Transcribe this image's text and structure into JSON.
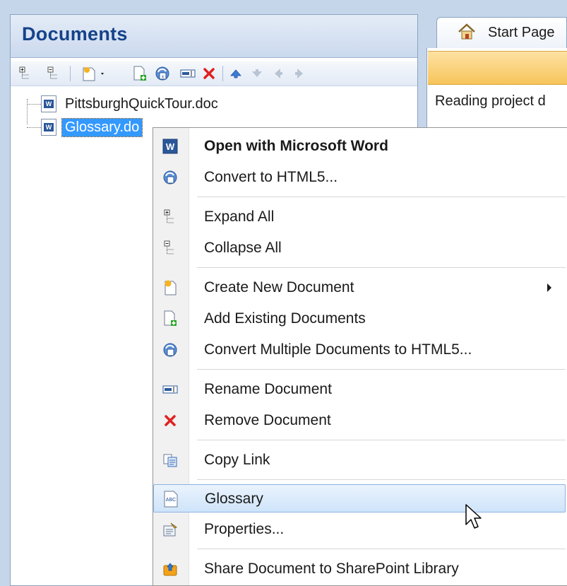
{
  "panel": {
    "title": "Documents",
    "toolbar": [
      {
        "name": "expand-all-tool",
        "icon": "expand-tree-icon"
      },
      {
        "name": "collapse-all-tool",
        "icon": "collapse-tree-icon"
      },
      {
        "name": "new-document-tool",
        "icon": "new-document-icon"
      },
      {
        "name": "add-existing-tool",
        "icon": "add-document-icon"
      },
      {
        "name": "convert-tool",
        "icon": "convert-icon"
      },
      {
        "name": "rename-tool",
        "icon": "rename-icon"
      },
      {
        "name": "remove-tool",
        "icon": "remove-icon"
      },
      {
        "name": "move-up-tool",
        "icon": "arrow-up-icon"
      },
      {
        "name": "move-down-tool",
        "icon": "arrow-down-icon"
      },
      {
        "name": "move-left-tool",
        "icon": "arrow-left-icon"
      },
      {
        "name": "move-right-tool",
        "icon": "arrow-right-icon"
      }
    ],
    "tree": [
      {
        "label": "PittsburghQuickTour.doc",
        "selected": false
      },
      {
        "label": "Glossary.do",
        "selected": true
      }
    ]
  },
  "start_tab": {
    "label": "Start Page",
    "status_text": "Reading project d"
  },
  "context_menu": {
    "items": [
      {
        "label": "Open with Microsoft Word",
        "icon": "word-icon",
        "bold": true
      },
      {
        "label": "Convert to HTML5...",
        "icon": "convert-icon"
      },
      {
        "label": "Expand All",
        "icon": "expand-tree-icon"
      },
      {
        "label": "Collapse All",
        "icon": "collapse-tree-icon"
      },
      {
        "label": "Create New Document",
        "icon": "new-document-icon",
        "submenu": true
      },
      {
        "label": "Add Existing Documents",
        "icon": "add-document-icon"
      },
      {
        "label": "Convert Multiple Documents to HTML5...",
        "icon": "convert-icon"
      },
      {
        "label": "Rename Document",
        "icon": "rename-icon"
      },
      {
        "label": "Remove Document",
        "icon": "remove-icon"
      },
      {
        "label": "Copy Link",
        "icon": "copy-link-icon"
      },
      {
        "label": "Glossary",
        "icon": "glossary-icon",
        "highlighted": true
      },
      {
        "label": "Properties...",
        "icon": "properties-icon"
      },
      {
        "label": "Share Document to SharePoint Library",
        "icon": "sharepoint-icon"
      }
    ]
  },
  "colors": {
    "panel_title": "#15428b",
    "selection": "#3399ff",
    "menu_hover": "#cfe4fa",
    "remove_red": "#e02020"
  }
}
